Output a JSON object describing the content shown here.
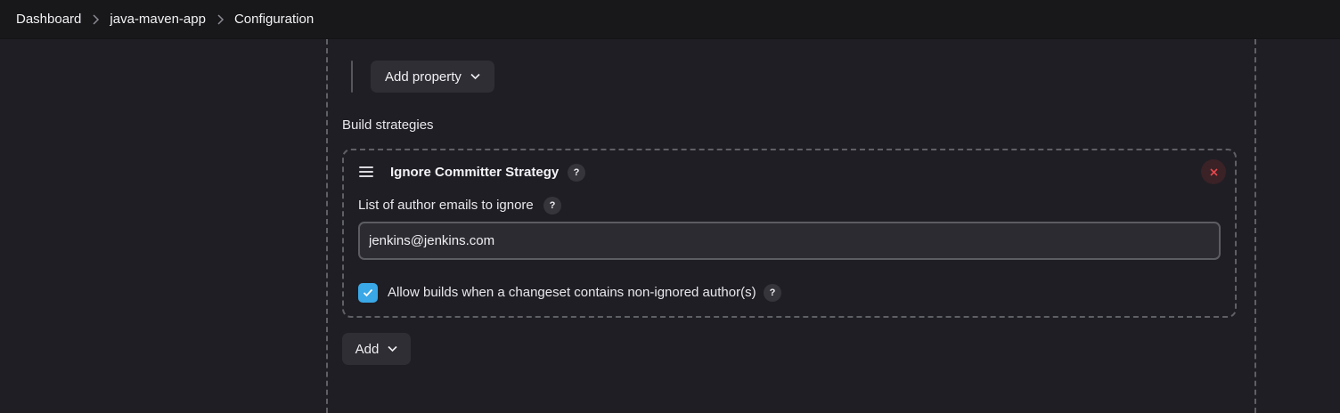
{
  "breadcrumb": {
    "items": [
      "Dashboard",
      "java-maven-app",
      "Configuration"
    ],
    "separator_icon": "chevron-right-icon"
  },
  "properties": {
    "add_property_label": "Add property",
    "dropdown_icon": "chevron-down-icon"
  },
  "build_strategies": {
    "label": "Build strategies",
    "strategy": {
      "title": "Ignore Committer Strategy",
      "help_symbol": "?",
      "drag_icon": "drag-handle-icon",
      "close_icon": "close-icon",
      "field": {
        "label": "List of author emails to ignore",
        "help_symbol": "?",
        "value": "jenkins@jenkins.com"
      },
      "checkbox": {
        "checked": true,
        "label": "Allow builds when a changeset contains non-ignored author(s)",
        "help_symbol": "?"
      }
    },
    "add_label": "Add"
  },
  "colors": {
    "background": "#1f1e24",
    "topbar": "#18181b",
    "button": "#2e2e34",
    "accent_checkbox": "#3aa7e6",
    "close_red": "#e5484d"
  }
}
